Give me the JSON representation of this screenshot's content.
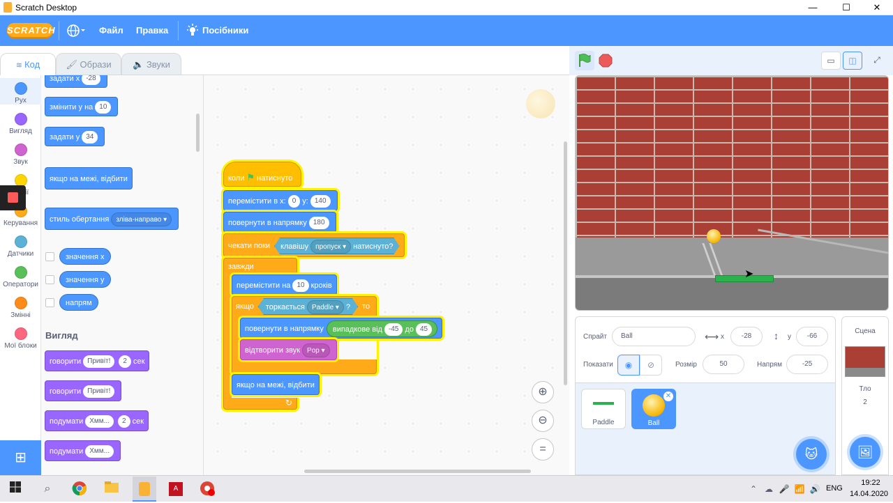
{
  "window": {
    "title": "Scratch Desktop",
    "min": "—",
    "max": "☐",
    "close": "✕"
  },
  "menu": {
    "logo": "SCRATCH",
    "globe": "🌐",
    "file": "Файл",
    "edit": "Правка",
    "tutorials": "Посібники"
  },
  "tabs": {
    "code": "Код",
    "costumes": "Образи",
    "sounds": "Звуки"
  },
  "categories": [
    {
      "label": "Рух",
      "color": "#4c97ff"
    },
    {
      "label": "Вигляд",
      "color": "#9966ff"
    },
    {
      "label": "Звук",
      "color": "#cf63cf"
    },
    {
      "label": "Події",
      "color": "#ffd500"
    },
    {
      "label": "Керування",
      "color": "#ffab19"
    },
    {
      "label": "Датчики",
      "color": "#5cb1d6"
    },
    {
      "label": "Оператори",
      "color": "#59c059"
    },
    {
      "label": "Змінні",
      "color": "#ff8c1a"
    },
    {
      "label": "Мої блоки",
      "color": "#ff6680"
    }
  ],
  "palette": {
    "set_x": "задати х",
    "set_x_val": "-28",
    "change_y": "змінити у на",
    "change_y_val": "10",
    "set_y": "задати у",
    "set_y_val": "34",
    "bounce": "якщо на межі, відбити",
    "rotation": "стиль обертання",
    "rotation_val": "зліва-направо",
    "rep_x": "значення х",
    "rep_y": "значення у",
    "rep_dir": "напрям",
    "looks_head": "Вигляд",
    "say_secs": "говорити",
    "say_secs_msg": "Привіт!",
    "say_secs_n": "2",
    "say_secs_unit": "сек",
    "say": "говорити",
    "say_msg": "Привіт!",
    "think_secs": "подумати",
    "think_secs_msg": "Хмм...",
    "think_secs_n": "2",
    "think_secs_unit": "сек",
    "think": "подумати",
    "think_msg": "Хмм..."
  },
  "script": {
    "hat_when": "коли",
    "hat_clicked": "натиснуто",
    "goto": "перемістити в х:",
    "goto_x": "0",
    "goto_y_lbl": "у:",
    "goto_y": "140",
    "point": "повернути в напрямку",
    "point_val": "180",
    "wait_until": "чекати поки",
    "key": "клавішу",
    "key_val": "пропуск",
    "pressed": "натиснуто?",
    "forever": "завжди",
    "move": "перемістити на",
    "move_val": "10",
    "steps": "кроків",
    "if": "якщо",
    "touching": "торкається",
    "touching_val": "Paddle",
    "q": "?",
    "then": "то",
    "point2": "повернути в напрямку",
    "random": "випадкове від",
    "rand_from": "-45",
    "rand_to_lbl": "до",
    "rand_to": "45",
    "play": "відтворити звук",
    "play_val": "Pop",
    "bounce2": "якщо на межі, відбити"
  },
  "sprite_info": {
    "sprite_lbl": "Спрайт",
    "sprite_name": "Ball",
    "x_lbl": "x",
    "x_val": "-28",
    "y_lbl": "y",
    "y_val": "-66",
    "show_lbl": "Показати",
    "size_lbl": "Розмір",
    "size_val": "50",
    "dir_lbl": "Напрям",
    "dir_val": "-25"
  },
  "sprites": [
    {
      "name": "Paddle"
    },
    {
      "name": "Ball"
    }
  ],
  "stage_panel": {
    "title": "Сцена",
    "backdrops_lbl": "Тло",
    "backdrops_count": "2"
  },
  "taskbar": {
    "lang": "ENG",
    "time": "19:22",
    "date": "14.04.2020"
  }
}
